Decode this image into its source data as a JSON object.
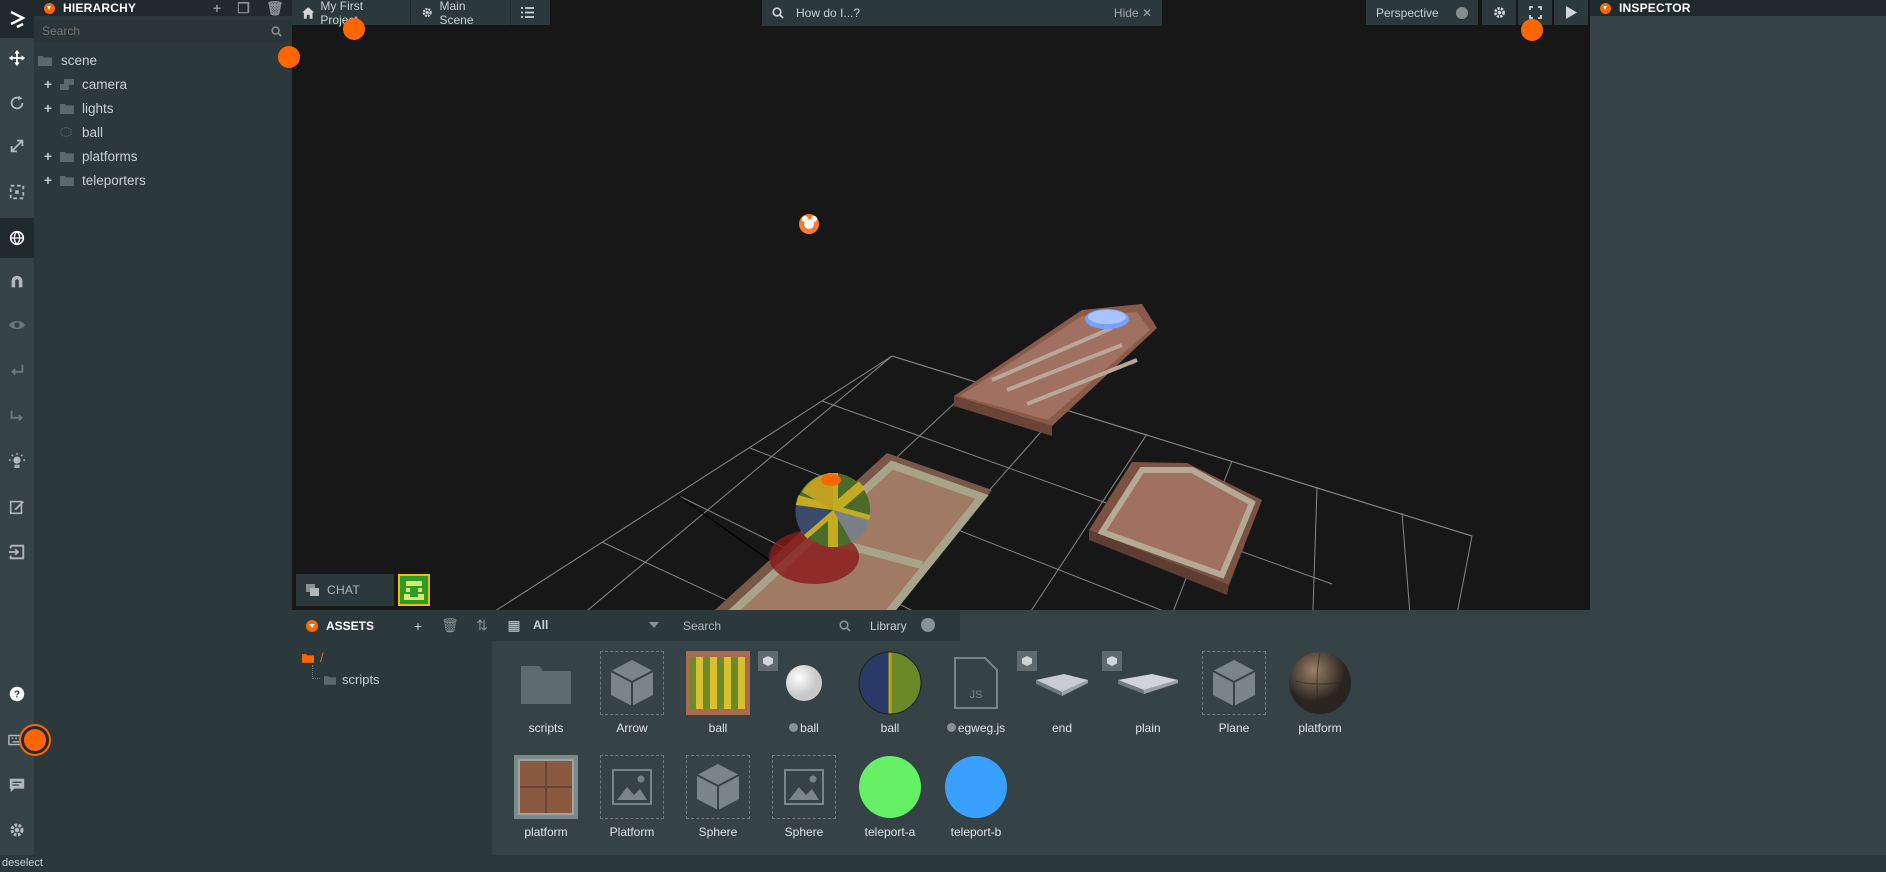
{
  "hierarchy": {
    "title": "HIERARCHY",
    "search_placeholder": "Search",
    "items": [
      {
        "label": "scene"
      },
      {
        "label": "camera"
      },
      {
        "label": "lights"
      },
      {
        "label": "ball"
      },
      {
        "label": "platforms"
      },
      {
        "label": "teleporters"
      }
    ]
  },
  "viewport": {
    "tabs": {
      "project": "My First Project",
      "scene": "Main Scene"
    },
    "help_search": {
      "text": "How do I...?",
      "hide": "Hide"
    },
    "camera_mode": "Perspective",
    "chat": "CHAT"
  },
  "inspector": {
    "title": "INSPECTOR"
  },
  "assets": {
    "title": "ASSETS",
    "filter": "All",
    "search_placeholder": "Search",
    "library": "Library",
    "tree": {
      "root": "/",
      "child": "scripts"
    },
    "items": [
      {
        "label": "scripts"
      },
      {
        "label": "Arrow"
      },
      {
        "label": "ball"
      },
      {
        "label": "ball"
      },
      {
        "label": "ball"
      },
      {
        "label": "egweg.js"
      },
      {
        "label": "end"
      },
      {
        "label": "plain"
      },
      {
        "label": "Plane"
      },
      {
        "label": "platform"
      },
      {
        "label": "platform"
      },
      {
        "label": "Platform"
      },
      {
        "label": "Sphere"
      },
      {
        "label": "Sphere"
      },
      {
        "label": "teleport-a"
      },
      {
        "label": "teleport-b"
      }
    ]
  },
  "statusbar": {
    "text": "deselect"
  },
  "colors": {
    "accent": "#ff6600",
    "panel": "#2c393c",
    "panel_dark": "#20292b",
    "viewport_bg": "#171717"
  }
}
